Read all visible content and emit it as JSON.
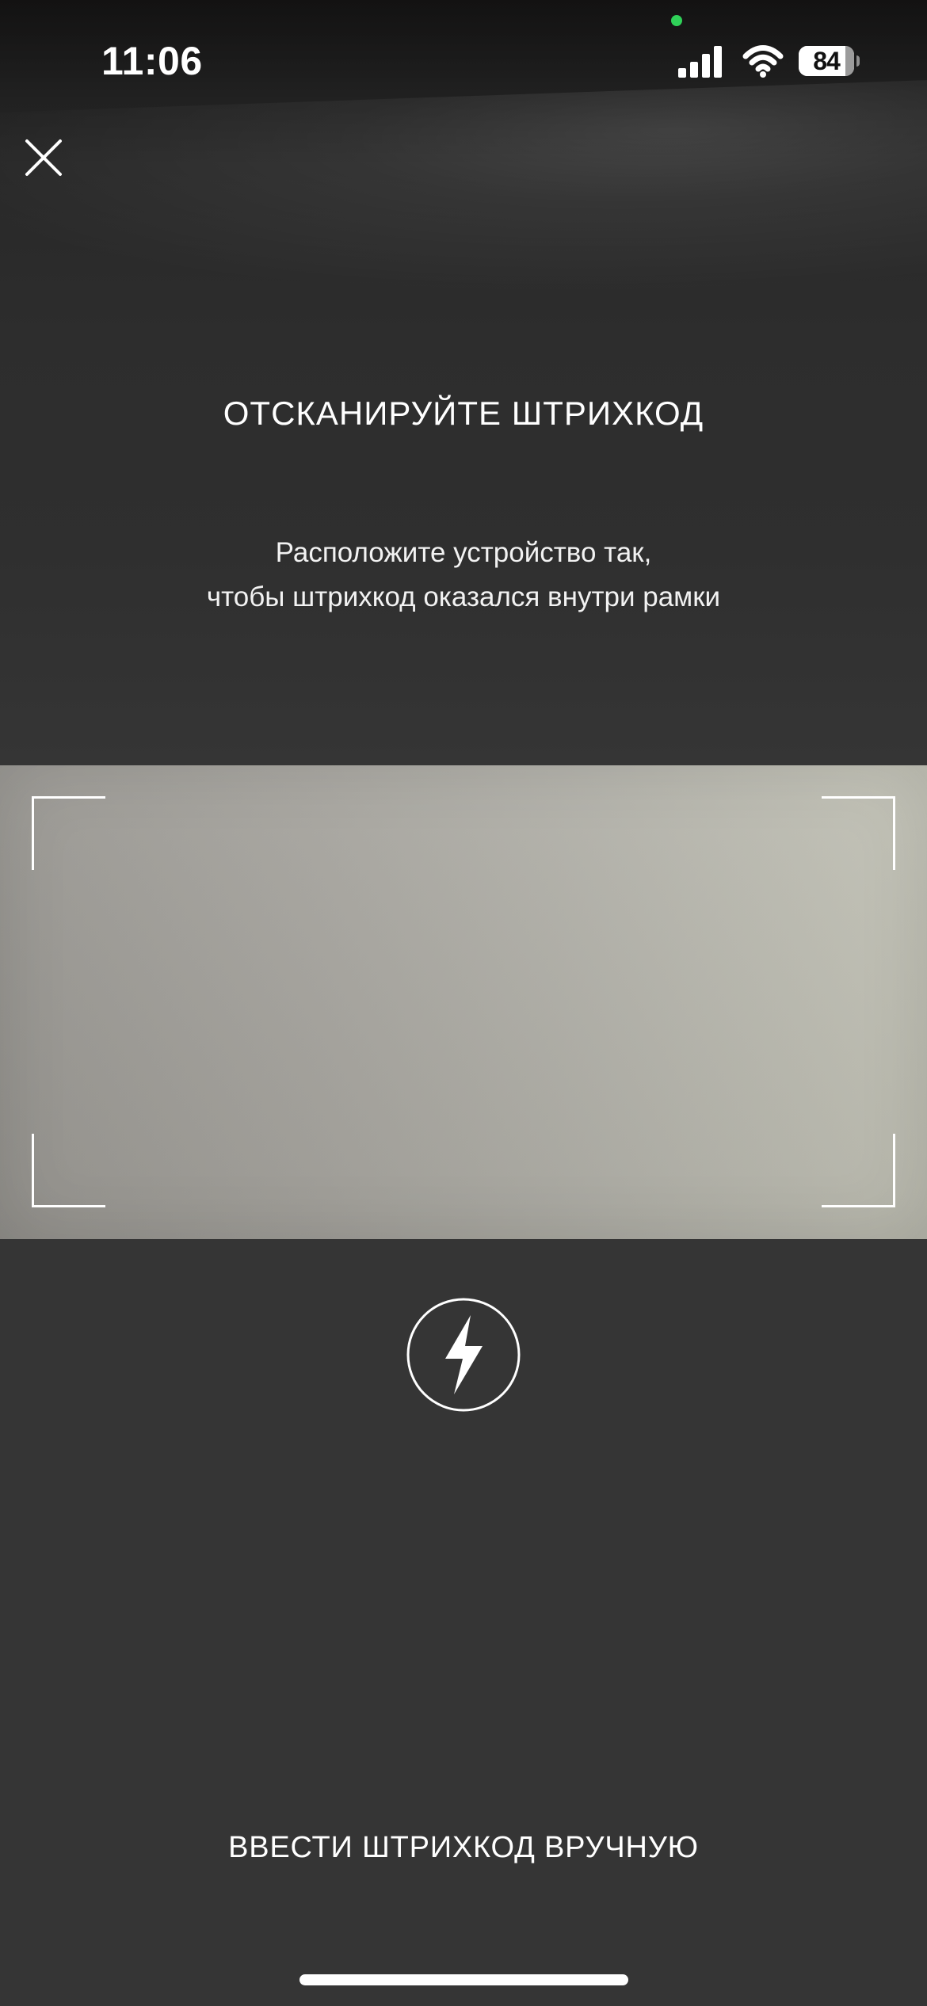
{
  "status_bar": {
    "time": "11:06",
    "battery_level": "84",
    "battery_fraction": 0.84,
    "icons": [
      "signal-icon",
      "wifi-icon",
      "battery-icon"
    ],
    "recording_indicator_color": "#2fd158"
  },
  "header": {
    "close_icon": "close-icon"
  },
  "instructions": {
    "title": "ОТСКАНИРУЙТЕ ШТРИХКОД",
    "line_1": "Расположите устройство так,",
    "line_2": "чтобы штрихкод оказался внутри рамки"
  },
  "scanner": {
    "frame": "scan-frame",
    "flash_icon": "flash-icon"
  },
  "actions": {
    "manual_entry": "ВВЕСТИ ШТРИХКОД ВРУЧНУЮ"
  },
  "colors": {
    "text": "#ffffff",
    "background_dark": "#2f2f2f",
    "scan_surface": "#aaa8a1",
    "home_indicator": "#ffffff"
  }
}
